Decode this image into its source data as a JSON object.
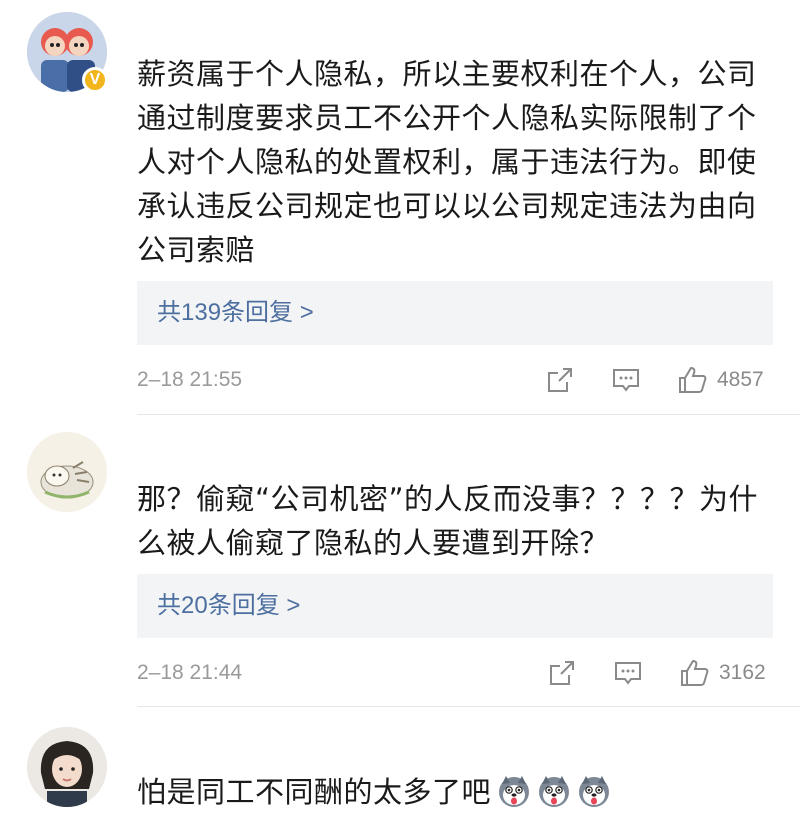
{
  "comments": [
    {
      "text": "薪资属于个人隐私，所以主要权利在个人，公司通过制度要求员工不公开个人隐私实际限制了个人对个人隐私的处置权利，属于违法行为。即使承认违反公司规定也可以以公司规定违法为由向公司索赔",
      "replies": "共139条回复 >",
      "time": "2–18 21:55",
      "likes": "4857",
      "verified_badge": "V"
    },
    {
      "text": "那？偷窥“公司机密”的人反而没事？？？？为什么被人偷窥了隐私的人要遭到开除？",
      "replies": "共20条回复 >",
      "time": "2–18 21:44",
      "likes": "3162"
    },
    {
      "text": "怕是同工不同酬的太多了吧",
      "emojis": [
        "husky-dog-emoji",
        "husky-dog-emoji",
        "husky-dog-emoji"
      ]
    }
  ],
  "icons": {
    "share": "share-icon",
    "comment": "comment-icon",
    "like": "thumbs-up-icon"
  },
  "colors": {
    "reply_link": "#4d6fa0",
    "verified": "#f3b51c",
    "meta_gray": "#9a9a9a"
  }
}
